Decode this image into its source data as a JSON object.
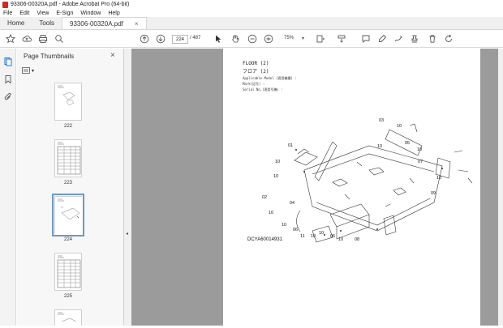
{
  "window": {
    "title": "93306-00320A.pdf - Adobe Acrobat Pro (64-bit)"
  },
  "menu": [
    "File",
    "Edit",
    "View",
    "E-Sign",
    "Window",
    "Help"
  ],
  "tabs": {
    "home": "Home",
    "tools": "Tools",
    "document": "93306-00320A.pdf",
    "close": "×"
  },
  "toolbar": {
    "page_current": "224",
    "page_total": "/ 487",
    "zoom": "75%"
  },
  "panel": {
    "title": "Page Thumbnails",
    "thumbnails": [
      {
        "label": "222"
      },
      {
        "label": "223"
      },
      {
        "label": "224",
        "selected": true
      },
      {
        "label": "225"
      }
    ]
  },
  "sheet": {
    "title_en": "FLOOR (2)",
    "title_jp": "フロア (2)",
    "meta1": "Applicable Model (適用機種) :",
    "meta2": "Mark(記号) :",
    "meta3": "Serial No.(適用号機) :",
    "doc_id": "DCYA60014931",
    "callouts": [
      "03",
      "01",
      "05",
      "10",
      "10",
      "10",
      "07",
      "10",
      "09",
      "10",
      "02",
      "04",
      "10",
      "10",
      "06",
      "11",
      "10",
      "06",
      "10",
      "08",
      "10",
      "10"
    ]
  },
  "colors": {
    "accent": "#1473e6",
    "pdf_red": "#d6281c"
  }
}
